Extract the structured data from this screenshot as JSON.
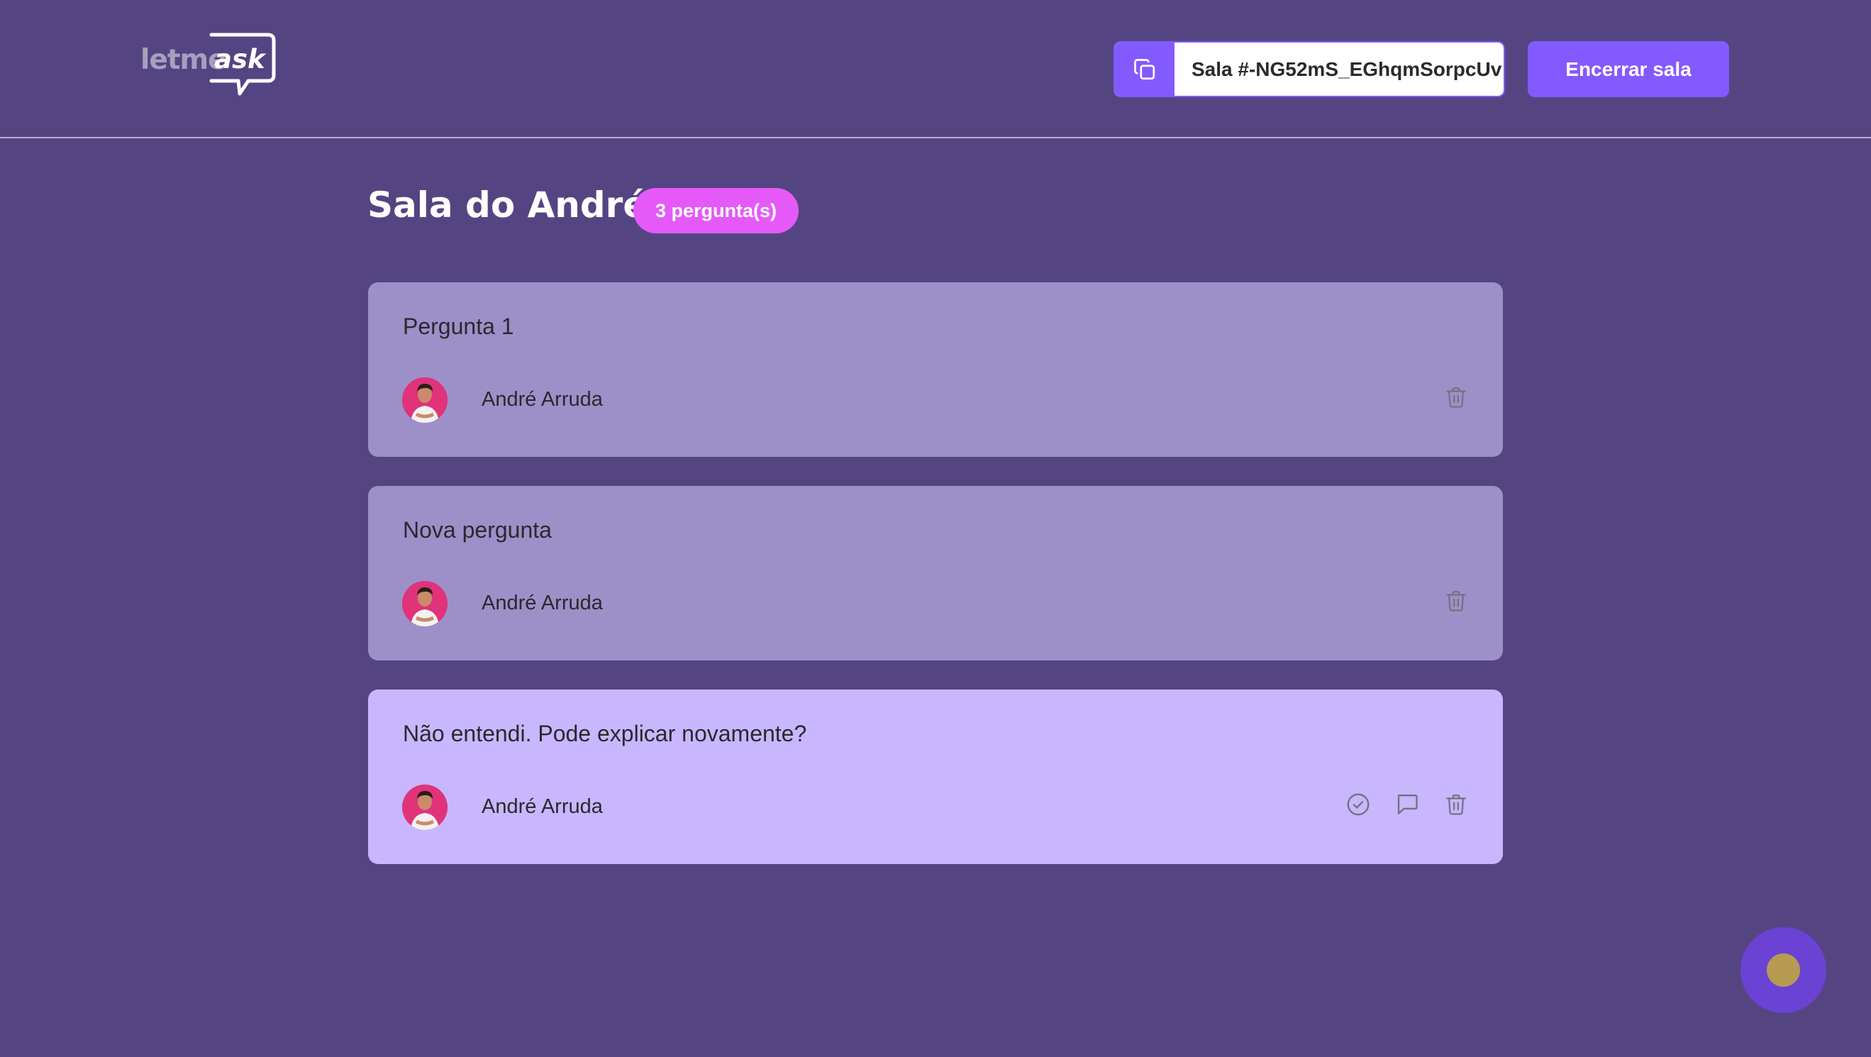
{
  "header": {
    "logo_part1": "letme",
    "logo_part2": "ask",
    "room_code_label": "Sala #-NG52mS_EGhqmSorpcUv",
    "close_room_label": "Encerrar sala",
    "copy_icon": "copy-icon"
  },
  "room": {
    "title": "Sala do André",
    "question_count": "3 pergunta(s)"
  },
  "questions": [
    {
      "text": "Pergunta 1",
      "author": "André Arruda",
      "actions": [
        "trash-icon"
      ]
    },
    {
      "text": "Nova pergunta",
      "author": "André Arruda",
      "actions": [
        "trash-icon"
      ]
    },
    {
      "text": "Não entendi. Pode explicar novamente?",
      "author": "André Arruda",
      "actions": [
        "check-circle-icon",
        "chat-bubble-icon",
        "trash-icon"
      ]
    }
  ],
  "colors": {
    "background": "#544582",
    "accent": "#835afd",
    "badge": "#e559f9",
    "answered_card": "#9d90c8",
    "active_card": "#c8b7fe"
  }
}
